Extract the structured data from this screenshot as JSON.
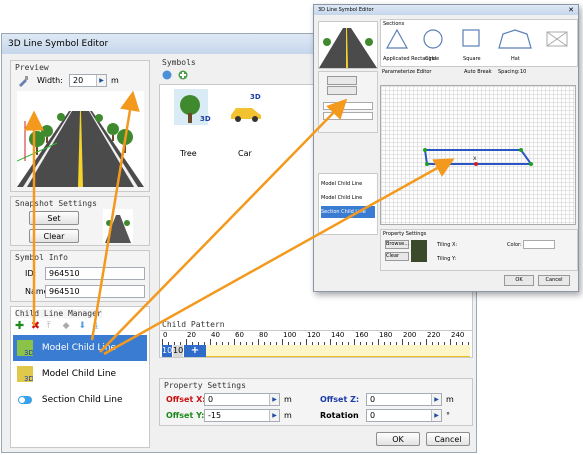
{
  "window": {
    "title": "3D Line Symbol Editor"
  },
  "preview": {
    "label": "Preview",
    "width_label": "Width:",
    "width_value": "20",
    "width_unit": "m"
  },
  "snapshot": {
    "label": "Snapshot Settings",
    "set": "Set",
    "clear": "Clear"
  },
  "symbol_info": {
    "label": "Symbol Info",
    "id_label": "ID:",
    "id_value": "964510",
    "name_label": "Name:",
    "name_value": "964510"
  },
  "child_manager": {
    "label": "Child Line Manager",
    "items": [
      {
        "label": "Model Child Line",
        "selected": true
      },
      {
        "label": "Model Child Line",
        "selected": false
      },
      {
        "label": "Section Child Line",
        "selected": false
      }
    ]
  },
  "symbols": {
    "label": "Symbols",
    "items": [
      {
        "name": "Tree",
        "badge": "3D"
      },
      {
        "name": "Car",
        "badge": "3D"
      }
    ]
  },
  "child_pattern": {
    "label": "Child Pattern",
    "ruler": [
      "0",
      "20",
      "40",
      "60",
      "80",
      "100",
      "120",
      "140",
      "160",
      "180",
      "200",
      "220",
      "240"
    ],
    "cells": [
      "10",
      "10"
    ],
    "add": "+"
  },
  "property_settings": {
    "label": "Property Settings",
    "offset_x_label": "Offset X:",
    "offset_x_value": "0",
    "offset_x_unit": "m",
    "offset_y_label": "Offset Y:",
    "offset_y_value": "-15",
    "offset_y_unit": "m",
    "offset_z_label": "Offset Z:",
    "offset_z_value": "0",
    "offset_z_unit": "m",
    "rotation_label": "Rotation",
    "rotation_value": "0",
    "rotation_unit": "°"
  },
  "footer": {
    "ok": "OK",
    "cancel": "Cancel"
  },
  "mini_window": {
    "title": "3D Line Symbol Editor",
    "sections_label": "Sections",
    "shapes": [
      "Applicated Rectangle",
      "Circle",
      "Square",
      "Hat",
      ""
    ],
    "parameterize_label": "Parameterize Editor",
    "auto_break": "Auto Break",
    "spacing_label": "Spacing:",
    "spacing_value": "10",
    "property_label": "Property Settings",
    "browse": "Browse...",
    "clear": "Clear",
    "tiling_x": "Tiling X:",
    "tiling_y": "Tiling Y:",
    "color": "Color:",
    "ok": "OK",
    "cancel": "Cancel",
    "left_items": [
      "Model Child Line",
      "Model Child Line",
      "Section Child Line"
    ]
  },
  "colors": {
    "arrow": "#f39a1e",
    "selection": "#3a7cd2",
    "accent_blue": "#1d3da8",
    "accent_red": "#cc1111",
    "accent_green": "#1d8a1d"
  }
}
